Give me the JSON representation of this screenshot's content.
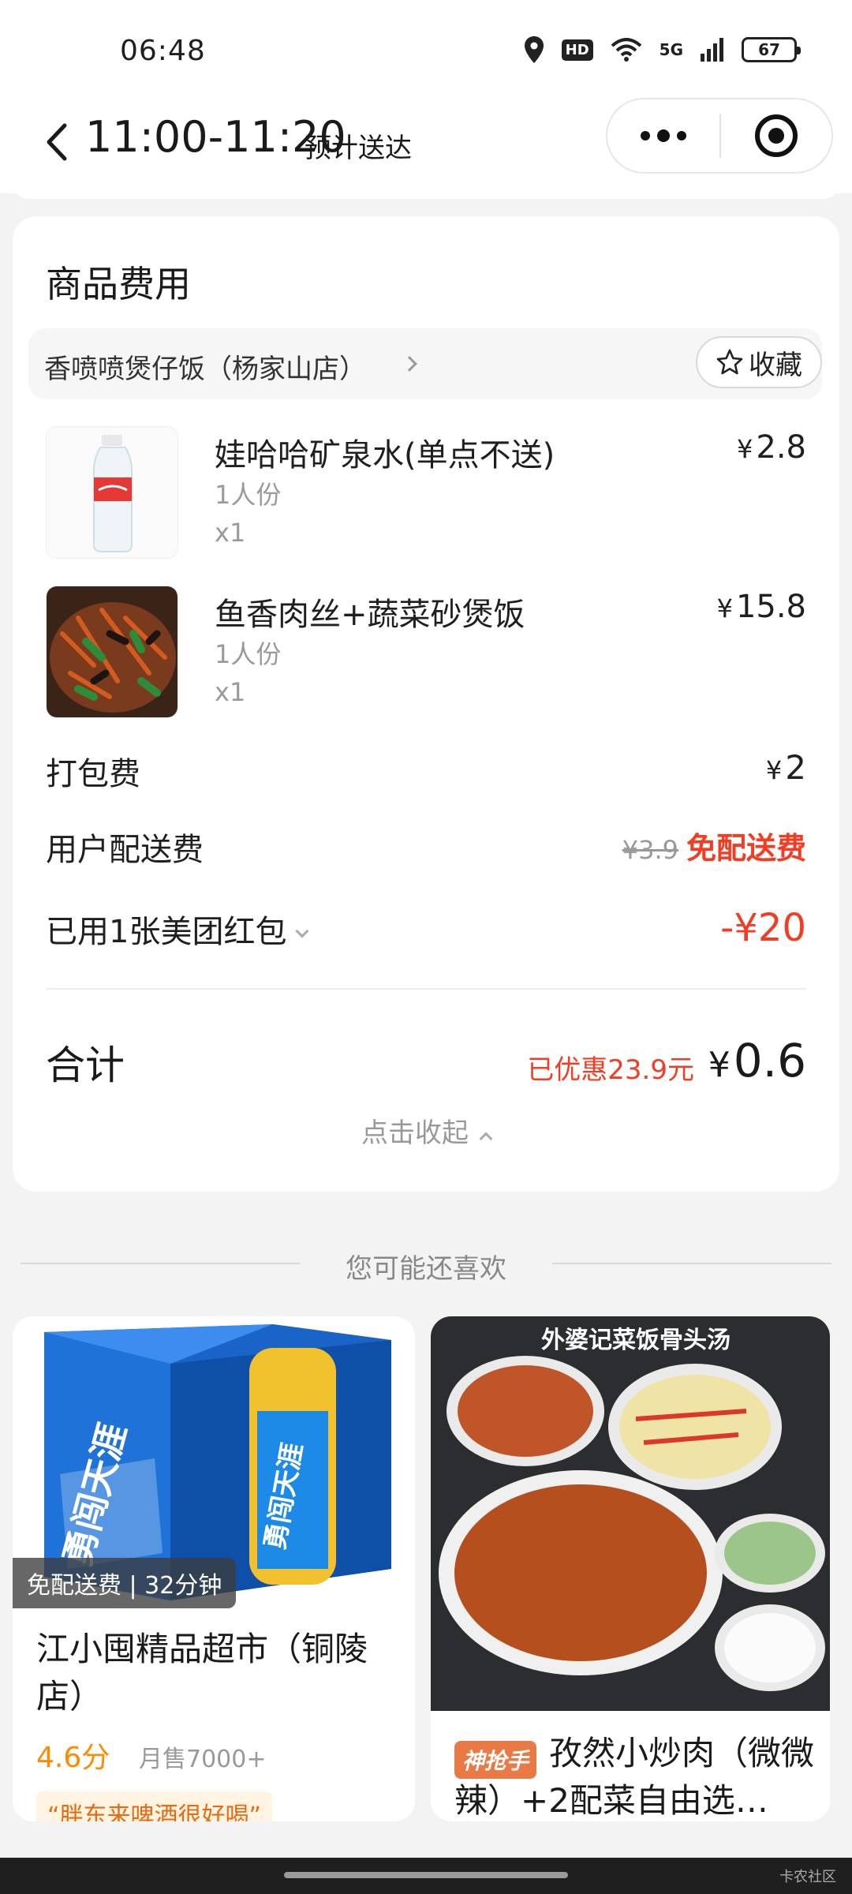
{
  "status_bar": {
    "time": "06:48",
    "hd": "HD",
    "network": "5G",
    "battery": "67"
  },
  "nav": {
    "time_range": "11:00-11:20",
    "subtitle": "预计送达"
  },
  "fee_card": {
    "title": "商品费用",
    "store_name": "香喷喷煲仔饭（杨家山店）",
    "favorite_label": "收藏",
    "items": [
      {
        "name": "娃哈哈矿泉水(单点不送)",
        "portion": "1人份",
        "qty": "x1",
        "price": "2.8"
      },
      {
        "name": "鱼香肉丝+蔬菜砂煲饭",
        "portion": "1人份",
        "qty": "x1",
        "price": "15.8"
      }
    ],
    "packing": {
      "label": "打包费",
      "value": "2"
    },
    "delivery": {
      "label": "用户配送费",
      "original": "¥3.9",
      "value": "免配送费"
    },
    "coupon": {
      "label": "已用1张美团红包",
      "value": "-¥20"
    },
    "total": {
      "label": "合计",
      "discount": "已优惠23.9元",
      "amount": "0.6"
    },
    "collapse_label": "点击收起",
    "yen": "¥"
  },
  "recommendations": {
    "title": "您可能还喜欢",
    "left": {
      "delivery_tag": "免配送费 | 32分钟",
      "name": "江小囤精品超市（铜陵店）",
      "rating": "4.6分",
      "sales": "月售7000+",
      "quote": "“胖东来啤酒很好喝”",
      "image_text": "勇闯天涯"
    },
    "right": {
      "badge": "神抢手",
      "name": "孜然小炒肉（微微辣）+2配菜自由选…",
      "image_text": "外婆记菜饭骨头汤"
    }
  },
  "watermark": "卡农社区",
  "colors": {
    "accent_red": "#f33c24",
    "rating_orange": "#ff8a00",
    "badge_orange": "#ea7a45"
  }
}
